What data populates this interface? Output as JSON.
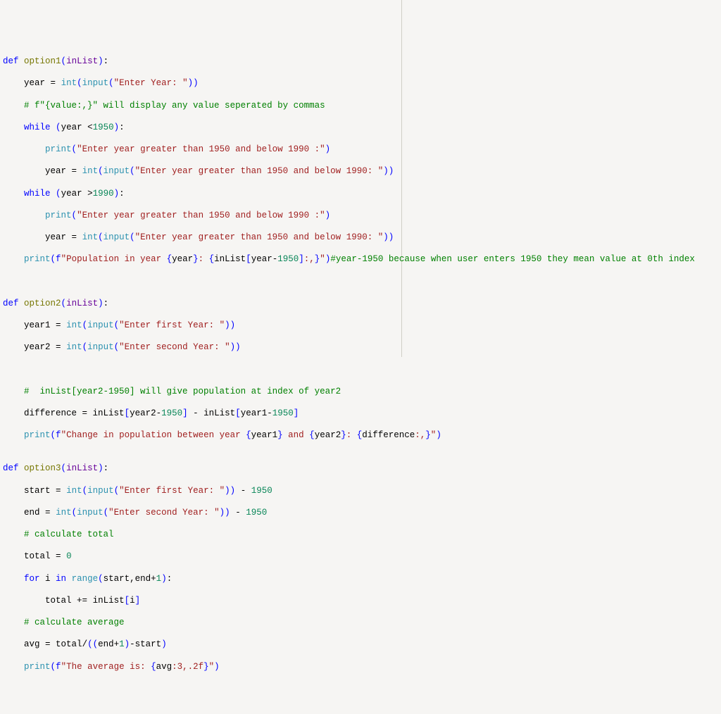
{
  "code": {
    "option1": {
      "def": "def",
      "name": "option1",
      "param": "inList",
      "lines": [
        {
          "pre": "    ",
          "tokens": [
            [
              "text",
              "year "
            ],
            [
              "op",
              "="
            ],
            [
              "text",
              " "
            ],
            [
              "builtin",
              "int"
            ],
            [
              "paren",
              "("
            ],
            [
              "builtin",
              "input"
            ],
            [
              "paren",
              "("
            ],
            [
              "str",
              "\"Enter Year: \""
            ],
            [
              "paren",
              "))"
            ]
          ]
        },
        {
          "pre": "    ",
          "tokens": [
            [
              "comment",
              "# f\"{value:,}\" will display any value seperated by commas"
            ]
          ]
        },
        {
          "pre": "    ",
          "tokens": [
            [
              "kw",
              "while"
            ],
            [
              "text",
              " "
            ],
            [
              "paren",
              "("
            ],
            [
              "text",
              "year "
            ],
            [
              "op",
              "<"
            ],
            [
              "num",
              "1950"
            ],
            [
              "paren",
              ")"
            ],
            [
              "text",
              ":"
            ]
          ]
        },
        {
          "pre": "        ",
          "tokens": [
            [
              "builtin",
              "print"
            ],
            [
              "paren",
              "("
            ],
            [
              "str",
              "\"Enter year greater than 1950 and below 1990 :\""
            ],
            [
              "paren",
              ")"
            ]
          ]
        },
        {
          "pre": "        ",
          "tokens": [
            [
              "text",
              "year "
            ],
            [
              "op",
              "="
            ],
            [
              "text",
              " "
            ],
            [
              "builtin",
              "int"
            ],
            [
              "paren",
              "("
            ],
            [
              "builtin",
              "input"
            ],
            [
              "paren",
              "("
            ],
            [
              "str",
              "\"Enter year greater than 1950 and below 1990: \""
            ],
            [
              "paren",
              "))"
            ]
          ]
        },
        {
          "pre": "    ",
          "tokens": [
            [
              "kw",
              "while"
            ],
            [
              "text",
              " "
            ],
            [
              "paren",
              "("
            ],
            [
              "text",
              "year "
            ],
            [
              "op",
              ">"
            ],
            [
              "num",
              "1990"
            ],
            [
              "paren",
              ")"
            ],
            [
              "text",
              ":"
            ]
          ]
        },
        {
          "pre": "        ",
          "tokens": [
            [
              "builtin",
              "print"
            ],
            [
              "paren",
              "("
            ],
            [
              "str",
              "\"Enter year greater than 1950 and below 1990 :\""
            ],
            [
              "paren",
              ")"
            ]
          ]
        },
        {
          "pre": "        ",
          "tokens": [
            [
              "text",
              "year "
            ],
            [
              "op",
              "="
            ],
            [
              "text",
              " "
            ],
            [
              "builtin",
              "int"
            ],
            [
              "paren",
              "("
            ],
            [
              "builtin",
              "input"
            ],
            [
              "paren",
              "("
            ],
            [
              "str",
              "\"Enter year greater than 1950 and below 1990: \""
            ],
            [
              "paren",
              "))"
            ]
          ]
        },
        {
          "pre": "    ",
          "tokens": [
            [
              "builtin",
              "print"
            ],
            [
              "paren",
              "("
            ],
            [
              "kw",
              "f"
            ],
            [
              "str",
              "\"Population in year "
            ],
            [
              "paren",
              "{"
            ],
            [
              "text",
              "year"
            ],
            [
              "paren",
              "}"
            ],
            [
              "str",
              ": "
            ],
            [
              "paren",
              "{"
            ],
            [
              "text",
              "inList"
            ],
            [
              "paren",
              "["
            ],
            [
              "text",
              "year"
            ],
            [
              "op",
              "-"
            ],
            [
              "num",
              "1950"
            ],
            [
              "paren",
              "]"
            ],
            [
              "str",
              ":,"
            ],
            [
              "paren",
              "}"
            ],
            [
              "str",
              "\""
            ],
            [
              "paren",
              ")"
            ],
            [
              "comment",
              "#year-1950 because when user enters 1950 they mean value at 0th index"
            ]
          ]
        }
      ]
    },
    "option2": {
      "def": "def",
      "name": "option2",
      "param": "inList",
      "lines": [
        {
          "pre": "    ",
          "tokens": [
            [
              "text",
              "year1 "
            ],
            [
              "op",
              "="
            ],
            [
              "text",
              " "
            ],
            [
              "builtin",
              "int"
            ],
            [
              "paren",
              "("
            ],
            [
              "builtin",
              "input"
            ],
            [
              "paren",
              "("
            ],
            [
              "str",
              "\"Enter first Year: \""
            ],
            [
              "paren",
              "))"
            ]
          ]
        },
        {
          "pre": "    ",
          "tokens": [
            [
              "text",
              "year2 "
            ],
            [
              "op",
              "="
            ],
            [
              "text",
              " "
            ],
            [
              "builtin",
              "int"
            ],
            [
              "paren",
              "("
            ],
            [
              "builtin",
              "input"
            ],
            [
              "paren",
              "("
            ],
            [
              "str",
              "\"Enter second Year: \""
            ],
            [
              "paren",
              "))"
            ]
          ]
        },
        {
          "pre": "",
          "tokens": []
        },
        {
          "pre": "    ",
          "tokens": [
            [
              "comment",
              "#  inList[year2-1950] will give population at index of year2"
            ]
          ]
        },
        {
          "pre": "    ",
          "tokens": [
            [
              "text",
              "difference "
            ],
            [
              "op",
              "="
            ],
            [
              "text",
              " inList"
            ],
            [
              "paren",
              "["
            ],
            [
              "text",
              "year2"
            ],
            [
              "op",
              "-"
            ],
            [
              "num",
              "1950"
            ],
            [
              "paren",
              "]"
            ],
            [
              "text",
              " "
            ],
            [
              "op",
              "-"
            ],
            [
              "text",
              " inList"
            ],
            [
              "paren",
              "["
            ],
            [
              "text",
              "year1"
            ],
            [
              "op",
              "-"
            ],
            [
              "num",
              "1950"
            ],
            [
              "paren",
              "]"
            ]
          ]
        },
        {
          "pre": "    ",
          "tokens": [
            [
              "builtin",
              "print"
            ],
            [
              "paren",
              "("
            ],
            [
              "kw",
              "f"
            ],
            [
              "str",
              "\"Change in population between year "
            ],
            [
              "paren",
              "{"
            ],
            [
              "text",
              "year1"
            ],
            [
              "paren",
              "}"
            ],
            [
              "str",
              " and "
            ],
            [
              "paren",
              "{"
            ],
            [
              "text",
              "year2"
            ],
            [
              "paren",
              "}"
            ],
            [
              "str",
              ": "
            ],
            [
              "paren",
              "{"
            ],
            [
              "text",
              "difference"
            ],
            [
              "str",
              ":,"
            ],
            [
              "paren",
              "}"
            ],
            [
              "str",
              "\""
            ],
            [
              "paren",
              ")"
            ]
          ]
        }
      ]
    },
    "option3": {
      "def": "def",
      "name": "option3",
      "param": "inList",
      "lines": [
        {
          "pre": "    ",
          "tokens": [
            [
              "text",
              "start "
            ],
            [
              "op",
              "="
            ],
            [
              "text",
              " "
            ],
            [
              "builtin",
              "int"
            ],
            [
              "paren",
              "("
            ],
            [
              "builtin",
              "input"
            ],
            [
              "paren",
              "("
            ],
            [
              "str",
              "\"Enter first Year: \""
            ],
            [
              "paren",
              "))"
            ],
            [
              "text",
              " "
            ],
            [
              "op",
              "-"
            ],
            [
              "text",
              " "
            ],
            [
              "num",
              "1950"
            ]
          ]
        },
        {
          "pre": "    ",
          "tokens": [
            [
              "text",
              "end "
            ],
            [
              "op",
              "="
            ],
            [
              "text",
              " "
            ],
            [
              "builtin",
              "int"
            ],
            [
              "paren",
              "("
            ],
            [
              "builtin",
              "input"
            ],
            [
              "paren",
              "("
            ],
            [
              "str",
              "\"Enter second Year: \""
            ],
            [
              "paren",
              "))"
            ],
            [
              "text",
              " "
            ],
            [
              "op",
              "-"
            ],
            [
              "text",
              " "
            ],
            [
              "num",
              "1950"
            ]
          ]
        },
        {
          "pre": "    ",
          "tokens": [
            [
              "comment",
              "# calculate total"
            ]
          ]
        },
        {
          "pre": "    ",
          "tokens": [
            [
              "text",
              "total "
            ],
            [
              "op",
              "="
            ],
            [
              "text",
              " "
            ],
            [
              "num",
              "0"
            ]
          ]
        },
        {
          "pre": "    ",
          "tokens": [
            [
              "kw",
              "for"
            ],
            [
              "text",
              " i "
            ],
            [
              "kw",
              "in"
            ],
            [
              "text",
              " "
            ],
            [
              "builtin",
              "range"
            ],
            [
              "paren",
              "("
            ],
            [
              "text",
              "start"
            ],
            [
              "op",
              ","
            ],
            [
              "text",
              "end"
            ],
            [
              "op",
              "+"
            ],
            [
              "num",
              "1"
            ],
            [
              "paren",
              ")"
            ],
            [
              "text",
              ":"
            ]
          ]
        },
        {
          "pre": "        ",
          "tokens": [
            [
              "text",
              "total "
            ],
            [
              "op",
              "+="
            ],
            [
              "text",
              " inList"
            ],
            [
              "paren",
              "["
            ],
            [
              "text",
              "i"
            ],
            [
              "paren",
              "]"
            ]
          ]
        },
        {
          "pre": "    ",
          "tokens": [
            [
              "comment",
              "# calculate average"
            ]
          ]
        },
        {
          "pre": "    ",
          "tokens": [
            [
              "text",
              "avg "
            ],
            [
              "op",
              "="
            ],
            [
              "text",
              " total"
            ],
            [
              "op",
              "/"
            ],
            [
              "paren",
              "(("
            ],
            [
              "text",
              "end"
            ],
            [
              "op",
              "+"
            ],
            [
              "num",
              "1"
            ],
            [
              "paren",
              ")"
            ],
            [
              "op",
              "-"
            ],
            [
              "text",
              "start"
            ],
            [
              "paren",
              ")"
            ]
          ]
        },
        {
          "pre": "    ",
          "tokens": [
            [
              "builtin",
              "print"
            ],
            [
              "paren",
              "("
            ],
            [
              "kw",
              "f"
            ],
            [
              "str",
              "\"The average is: "
            ],
            [
              "paren",
              "{"
            ],
            [
              "text",
              "avg"
            ],
            [
              "str",
              ":3,.2f"
            ],
            [
              "paren",
              "}"
            ],
            [
              "str",
              "\""
            ],
            [
              "paren",
              ")"
            ]
          ]
        }
      ]
    }
  }
}
